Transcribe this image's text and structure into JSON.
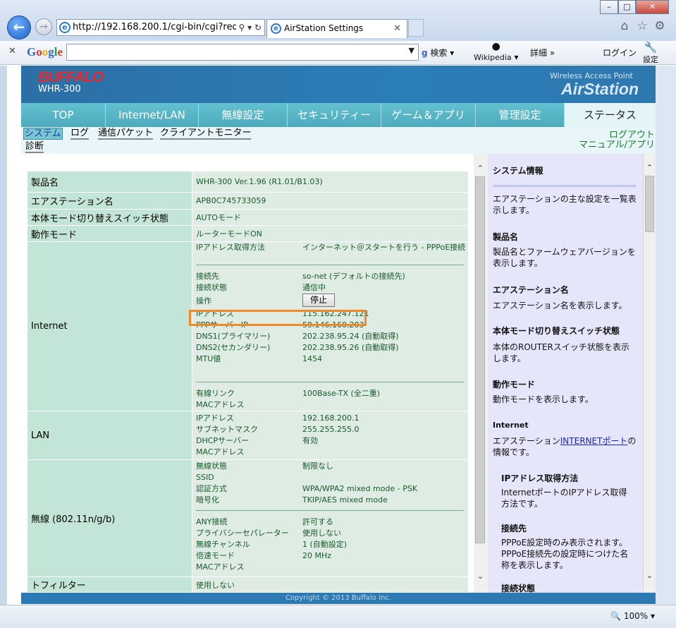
{
  "browser": {
    "url": "http://192.168.200.1/cgi-bin/cgi?req",
    "tab_title": "AirStation Settings",
    "window_controls": [
      "–",
      "□",
      "✕"
    ],
    "zoom": "100%"
  },
  "google_toolbar": {
    "logo": "Google",
    "search_label": "検索",
    "wikipedia": "Wikipedia",
    "details": "詳細 »",
    "login": "ログイン",
    "settings": "設定"
  },
  "banner": {
    "brand": "BUFFALO",
    "model": "WHR-300",
    "subtitle": "Wireless Access Point",
    "product": "AirStation"
  },
  "nav": {
    "tabs": [
      "TOP",
      "Internet/LAN",
      "無線設定",
      "セキュリティー",
      "ゲーム＆アプリ",
      "管理設定",
      "ステータス"
    ],
    "active_index": 6
  },
  "subnav": {
    "items": [
      "システム",
      "ログ",
      "通信パケット",
      "クライアントモニター",
      "診断"
    ],
    "logout": "ログアウト",
    "manual": "マニュアル/アプリ"
  },
  "info": {
    "product_name": {
      "label": "製品名",
      "value": "WHR-300 Ver.1.96 (R1.01/B1.03)"
    },
    "station_name": {
      "label": "エアステーション名",
      "value": "APB0C745733059"
    },
    "mode_switch": {
      "label": "本体モード切り替えスイッチ状態",
      "value": "AUTOモード"
    },
    "operation_mode": {
      "label": "動作モード",
      "value": "ルーターモードON"
    },
    "internet": {
      "label": "Internet",
      "method_key": "IPアドレス取得方法",
      "method_value": "インターネット＠スタートを行う - PPPoE接続",
      "dest_key": "接続先",
      "dest_value": "so-net (デフォルトの接続先)",
      "state_key": "接続状態",
      "state_value": "通信中",
      "op_key": "操作",
      "stop_button": "停止",
      "ip_key": "IPアドレス",
      "ip_value": "115.162.247.121",
      "ppp_key": "PPPサーバーIP",
      "ppp_value": "59.146.160.203",
      "dns1_key": "DNS1(プライマリー)",
      "dns1_value": "202.238.95.24 (自動取得)",
      "dns2_key": "DNS2(セカンダリー)",
      "dns2_value": "202.238.95.26 (自動取得)",
      "mtu_key": "MTU値",
      "mtu_value": "1454",
      "link_key": "有線リンク",
      "link_value": "100Base-TX (全二重)",
      "mac_key": "MACアドレス"
    },
    "lan": {
      "label": "LAN",
      "ip_key": "IPアドレス",
      "ip_value": "192.168.200.1",
      "mask_key": "サブネットマスク",
      "mask_value": "255.255.255.0",
      "dhcp_key": "DHCPサーバー",
      "dhcp_value": "有効",
      "mac_key": "MACアドレス"
    },
    "wireless": {
      "label": "無線 (802.11n/g/b)",
      "status_key": "無線状態",
      "status_value": "制限なし",
      "ssid_key": "SSID",
      "auth_key": "認証方式",
      "auth_value": "WPA/WPA2 mixed mode - PSK",
      "enc_key": "暗号化",
      "enc_value": "TKIP/AES mixed mode",
      "any_key": "ANY接続",
      "any_value": "許可する",
      "privacy_key": "プライバシーセパレーター",
      "privacy_value": "使用しない",
      "channel_key": "無線チャンネル",
      "channel_value": "1 (自動設定)",
      "speed_key": "倍速モード",
      "speed_value": "20 MHz",
      "mac_key": "MACアドレス"
    },
    "filter": {
      "label": "トフィルター",
      "value": "使用しない"
    }
  },
  "help": {
    "title": "システム情報",
    "intro": "エアステーションの主な設定を一覧表示します。",
    "product_title": "製品名",
    "product_body": "製品名とファームウェアバージョンを表示します。",
    "station_title": "エアステーション名",
    "station_body": "エアステーション名を表示します。",
    "switch_title": "本体モード切り替えスイッチ状態",
    "switch_body": "本体のROUTERスイッチ状態を表示します。",
    "mode_title": "動作モード",
    "mode_body": "動作モードを表示します。",
    "internet_title": "Internet",
    "internet_body_pre": "エアステーション",
    "internet_body_link": "INTERNETポート",
    "internet_body_post": "の情報です。",
    "ipmethod_title": "IPアドレス取得方法",
    "ipmethod_body": "InternetポートのIPアドレス取得方法です。",
    "dest_title": "接続先",
    "dest_body": "PPPoE設定時のみ表示されます。PPPoE接続先の設定時につけた名称を表示します。",
    "state_title": "接続状態"
  },
  "footer": {
    "copyright": "Copyright © 2013 Buffalo Inc."
  },
  "colors": {
    "banner": "#2c7eb8",
    "nav": "#5cb7c8",
    "highlight": "#f0892a",
    "value_text": "#17592b"
  }
}
